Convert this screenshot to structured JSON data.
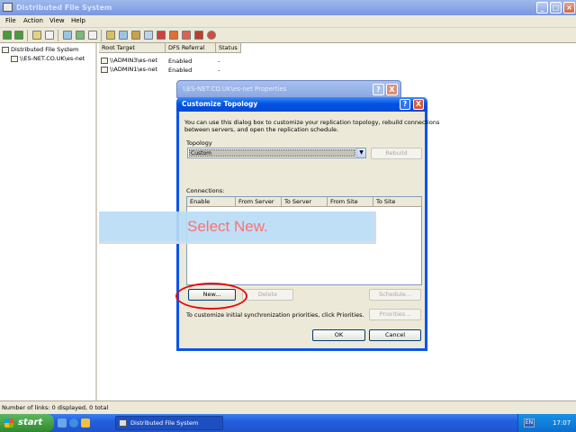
{
  "window": {
    "title": "Distributed File System",
    "app_icon": "dfs-console-icon"
  },
  "menu": [
    "File",
    "Action",
    "View",
    "Help"
  ],
  "toolbar_icons": [
    "back-icon",
    "forward-icon",
    "up-icon",
    "show-hide-tree-icon",
    "refresh-icon",
    "export-icon",
    "new-root-icon",
    "help-icon",
    "filter-icon",
    "properties-icon",
    "check-status-icon",
    "stop-icon",
    "delete-icon"
  ],
  "tree": {
    "root": "Distributed File System",
    "child": "\\\\ES-NET.CO.UK\\es-net"
  },
  "table": {
    "columns": [
      "Root Target",
      "DFS Referral",
      "Status"
    ],
    "rows": [
      {
        "target": "\\\\ADMIN3\\es-net",
        "referral": "Enabled",
        "status": "-"
      },
      {
        "target": "\\\\ADMIN1\\es-net",
        "referral": "Enabled",
        "status": "-"
      }
    ]
  },
  "status_bar": "Number of links: 0 displayed, 0 total",
  "properties_dialog": {
    "title": "\\\\ES-NET.CO.UK\\es-net Properties",
    "help_label": "?",
    "close_label": "X"
  },
  "dialog": {
    "title": "Customize Topology",
    "help_label": "?",
    "close_label": "X",
    "description_line1": "You can use this dialog box to customize your replication topology, rebuild connections",
    "description_line2": "between servers, and open the replication schedule.",
    "topology_label": "Topology",
    "topology_value": "Custom",
    "rebuild_label": "Rebuild",
    "connections_label": "Connections:",
    "connection_columns": [
      "Enable",
      "From Server",
      "To Server",
      "From Site",
      "To Site"
    ],
    "new_label": "New...",
    "delete_label": "Delete",
    "schedule_label": "Schedule...",
    "priorities_text": "To customize initial synchronization priorities, click Priorities.",
    "priorities_label": "Priorities...",
    "ok_label": "OK",
    "cancel_label": "Cancel"
  },
  "overlay": {
    "instruction": "Select New."
  },
  "taskbar": {
    "start_label": "start",
    "task_label": "Distributed File System",
    "language": "EN",
    "clock": "17:07"
  }
}
